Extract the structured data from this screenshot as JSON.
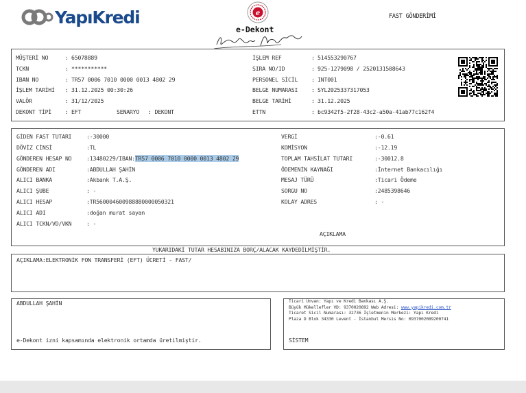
{
  "header": {
    "brand_logo": "YapıKredi",
    "doc_title": "e-Dekont",
    "transfer_type": "FAST GÖNDERİMİ"
  },
  "top": {
    "left": [
      {
        "label": "MÜŞTERİ NO",
        "sep": ":",
        "value": "65078889"
      },
      {
        "label": "TCKN",
        "sep": ":",
        "value": "***********"
      },
      {
        "label": "IBAN NO",
        "sep": ":",
        "value": "TR57 0006 7010 0000 0013 4802 29"
      },
      {
        "label": "İŞLEM TARİHİ",
        "sep": ":",
        "value": "31.12.2025 00:30:26"
      },
      {
        "label": "VALÖR",
        "sep": ":",
        "value": "31/12/2025"
      },
      {
        "label": "DEKONT TİPİ",
        "sep": ":",
        "value": "EFT"
      }
    ],
    "scenario_label": "SENARYO",
    "scenario_value": ": DEKONT",
    "right": [
      {
        "label": "İŞLEM REF",
        "sep": ":",
        "value": "514553290767"
      },
      {
        "label": "SIRA NO/ID",
        "sep": ":",
        "value": "925-1279098 / 2520131508643"
      },
      {
        "label": "PERSONEL SİCİL",
        "sep": ":",
        "value": "INT001"
      },
      {
        "label": "BELGE NUMARASI",
        "sep": ":",
        "value": "SYL2025337317053"
      },
      {
        "label": "BELGE TARİHİ",
        "sep": ":",
        "value": "31.12.2025"
      },
      {
        "label": "ETTN",
        "sep": ":",
        "value": "bc9342f5-2f28-43c2-a50a-41ab77c162f4"
      }
    ]
  },
  "mid": {
    "left": [
      {
        "label": "GİDEN FAST TUTARI",
        "value": ":-30000"
      },
      {
        "label": "DÖVİZ CİNSİ",
        "value": ":TL"
      },
      {
        "label": "GÖNDEREN HESAP NO",
        "value": ":13480229/IBAN:",
        "highlight": "TR57 0006 7010 0000 0013 4802 29"
      },
      {
        "label": "GÖNDEREN ADI",
        "value": ":ABDULLAH ŞAHİN"
      },
      {
        "label": "ALICI BANKA",
        "value": ":Akbank T.A.Ş."
      },
      {
        "label": "ALICI ŞUBE",
        "value": ": -"
      },
      {
        "label": "ALICI HESAP",
        "value": ":TR560004600988880000050321"
      },
      {
        "label": "ALICI ADI",
        "value": ":doğan murat sayan"
      },
      {
        "label": "ALICI TCKN/VD/VKN",
        "value": ": -"
      }
    ],
    "right": [
      {
        "label": "VERGİ",
        "value": ":-0.61"
      },
      {
        "label": "KOMİSYON",
        "value": ":-12.19"
      },
      {
        "label": "TOPLAM TAHSİLAT TUTARI",
        "value": ":-30012.8"
      },
      {
        "label": "ÖDEMENİN KAYNAĞI",
        "value": ":İnternet Bankacılığı"
      },
      {
        "label": "MESAJ TÜRÜ",
        "value": ":Ticari Ödeme"
      },
      {
        "label": "SORGU NO",
        "value": ":2485398646"
      },
      {
        "label": "KOLAY ADRES",
        "value": ": -"
      }
    ],
    "aciklama_heading": "AÇIKLAMA"
  },
  "notice": "YUKARIDAKİ TUTAR HESABINIZA BORÇ/ALACAK KAYDEDİLMİŞTİR.",
  "description": "AÇIKLAMA:ELEKTRONİK FON TRANSFERİ (EFT) ÜCRETİ - FAST/",
  "bottom_left": {
    "name": "ABDULLAH ŞAHİN",
    "footnote": "e-Dekont izni kapsamında elektronik ortamda üretilmiştir."
  },
  "bottom_right": {
    "line1": "Ticari Ünvan: Yapı ve Kredi Bankası A.Ş.",
    "line2_prefix": "Büyük Mükellefler VD: 9370020892 Web Adresi: ",
    "line2_link": "www.yapikredi.com.tr",
    "line3": "Ticaret Sicil Numarası: 32736 İşletmenin Merkezi: Yapı Kredi",
    "line4": "Plaza D Blok 34330 Levent - İstanbul Mersis No: 0937002089200741",
    "system": "SİSTEM"
  },
  "colors": {
    "brand_blue": "#1a4a8c",
    "highlight": "#a9cbe8",
    "seal_red": "#c8102e"
  }
}
